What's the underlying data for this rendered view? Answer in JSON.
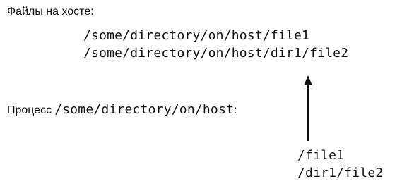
{
  "host": {
    "label": "Файлы на хосте:",
    "paths": [
      "/some/directory/on/host/file1",
      "/some/directory/on/host/dir1/file2"
    ]
  },
  "process": {
    "label": "Процесс",
    "path": "/some/directory/on/host",
    "suffix": ":"
  },
  "container": {
    "paths": [
      "/file1",
      "/dir1/file2"
    ]
  }
}
